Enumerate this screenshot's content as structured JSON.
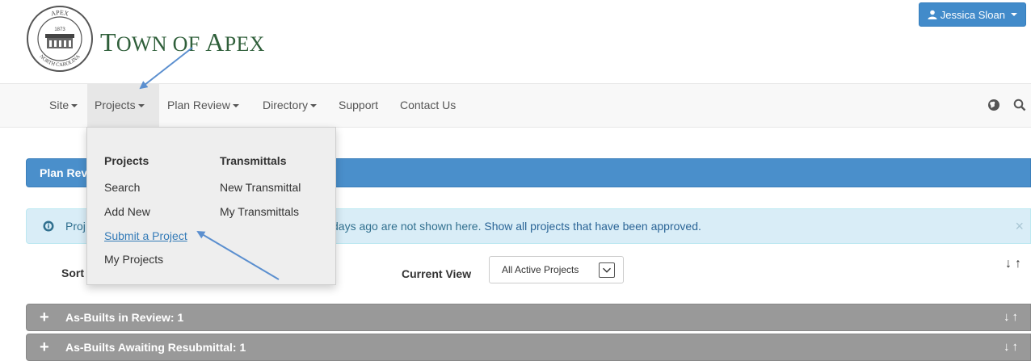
{
  "header": {
    "seal_text_top": "APEX",
    "seal_text_year": "1873",
    "seal_text_bottom": "NORTH CAROLINA",
    "town_name_first": "T",
    "town_name_mid": "OWN OF ",
    "town_name_a": "A",
    "town_name_rest": "PEX",
    "user_name": "Jessica Sloan"
  },
  "navbar": {
    "items": [
      {
        "label": "Site"
      },
      {
        "label": "Projects"
      },
      {
        "label": "Plan Review"
      },
      {
        "label": "Directory"
      },
      {
        "label": "Support"
      },
      {
        "label": "Contact Us"
      }
    ],
    "icons": [
      "globe-icon",
      "search-icon"
    ]
  },
  "dropdown": {
    "col1": {
      "heading": "Projects",
      "items": [
        "Search",
        "Add New",
        "Submit a Project",
        "My Projects"
      ]
    },
    "col2": {
      "heading": "Transmittals",
      "items": [
        "New Transmittal",
        "My Transmittals"
      ]
    }
  },
  "plan_bar": {
    "label": "Plan Rev"
  },
  "info_alert": {
    "text_start": "Proj",
    "text_end": "days ago are not shown here.",
    "link": "Show all projects that have been approved.",
    "close": "×"
  },
  "controls": {
    "sort_label": "Sort",
    "view_label": "Current View",
    "view_value": "All Active Projects",
    "sort_arrows": "↓↑"
  },
  "groups": [
    {
      "label": "As-Builts in Review: 1",
      "arrows": "↓↑"
    },
    {
      "label": "As-Builts Awaiting Resubmittal: 1",
      "arrows": "↓↑"
    }
  ],
  "colors": {
    "primary": "#428bca",
    "town_green": "#2f5f3a",
    "group_gray": "#999999",
    "info_bg": "#d9edf7",
    "annotation": "#5b8fcf"
  }
}
